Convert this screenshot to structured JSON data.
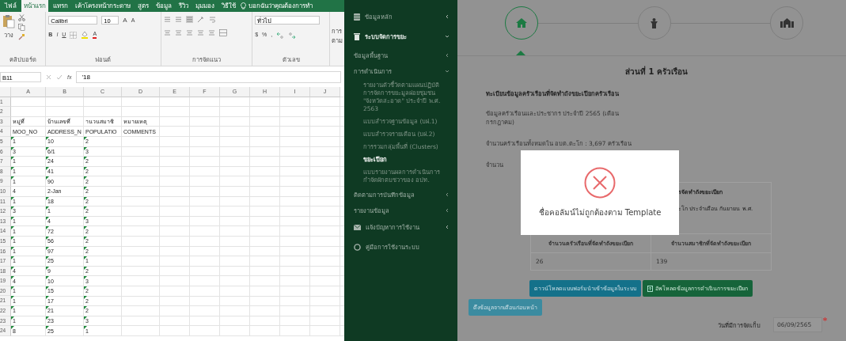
{
  "excel": {
    "tabs": [
      {
        "label": "ไฟล์",
        "selected": false
      },
      {
        "label": "หน้าแรก",
        "selected": true
      },
      {
        "label": "แทรก",
        "selected": false
      },
      {
        "label": "เค้าโครงหน้ากระดาษ",
        "selected": false
      },
      {
        "label": "สูตร",
        "selected": false
      },
      {
        "label": "ข้อมูล",
        "selected": false
      },
      {
        "label": "รีวิว",
        "selected": false
      },
      {
        "label": "มุมมอง",
        "selected": false
      },
      {
        "label": "วิธีใช้",
        "selected": false
      }
    ],
    "tell_me": "บอกฉันว่าคุณต้องการทำ",
    "ribbon": {
      "paste_label": "วาง",
      "font_name": "Calibri",
      "font_size": "10",
      "grow_font": "A",
      "shrink_font": "A",
      "bold": "B",
      "italic": "I",
      "underline": "U",
      "font_color": "A",
      "number_format": "ทั่วไป",
      "currency": "$",
      "percent": "%",
      "comma": ",",
      "cut_label": [
        "การ",
        "ตาม"
      ],
      "groups": [
        "คลิปบอร์ด",
        "ฟอนต์",
        "การจัดแนว",
        "ตัวเลข"
      ]
    },
    "name_box": "B11",
    "function_label": "fx",
    "formula": "'18",
    "columns": [
      "A",
      "B",
      "C",
      "D",
      "E",
      "F",
      "G",
      "H",
      "I",
      "J"
    ],
    "rows": [
      {
        "header": "1"
      },
      {
        "header": "2"
      },
      {
        "header": "3",
        "cells": [
          {
            "text": "หมู่ที่",
            "flag": false
          },
          {
            "text": "บ้านเลขที่",
            "flag": false
          },
          {
            "text": "านวนสมาชิ",
            "flag": false
          },
          {
            "text": "หมายเหตุ",
            "flag": false
          }
        ]
      },
      {
        "header": "4",
        "cells": [
          {
            "text": "MOO_NO",
            "flag": false
          },
          {
            "text": "ADDRESS_N",
            "flag": false
          },
          {
            "text": "POPULATIO",
            "flag": false
          },
          {
            "text": "COMMENTS",
            "flag": false
          }
        ]
      },
      {
        "header": "5",
        "cells": [
          {
            "text": "1",
            "flag": true
          },
          {
            "text": "10",
            "flag": true
          },
          {
            "text": "2",
            "flag": true
          }
        ]
      },
      {
        "header": "6",
        "cells": [
          {
            "text": "3",
            "flag": true
          },
          {
            "text": "6/1",
            "flag": true
          },
          {
            "text": "3",
            "flag": true
          }
        ]
      },
      {
        "header": "7",
        "cells": [
          {
            "text": "1",
            "flag": true
          },
          {
            "text": "24",
            "flag": true
          },
          {
            "text": "2",
            "flag": true
          }
        ]
      },
      {
        "header": "8",
        "cells": [
          {
            "text": "1",
            "flag": true
          },
          {
            "text": "41",
            "flag": true
          },
          {
            "text": "2",
            "flag": true
          }
        ]
      },
      {
        "header": "9",
        "cells": [
          {
            "text": "1",
            "flag": true
          },
          {
            "text": "90",
            "flag": true
          },
          {
            "text": "2",
            "flag": true
          }
        ]
      },
      {
        "header": "10",
        "cells": [
          {
            "text": "4",
            "flag": false
          },
          {
            "text": "2-Jan",
            "flag": false
          },
          {
            "text": "2",
            "flag": true
          }
        ]
      },
      {
        "header": "11",
        "cells": [
          {
            "text": "1",
            "flag": true
          },
          {
            "text": "18",
            "flag": true
          },
          {
            "text": "2",
            "flag": true
          }
        ]
      },
      {
        "header": "12",
        "cells": [
          {
            "text": "3",
            "flag": true
          },
          {
            "text": "1",
            "flag": true
          },
          {
            "text": "2",
            "flag": true
          }
        ]
      },
      {
        "header": "13",
        "cells": [
          {
            "text": "1",
            "flag": true
          },
          {
            "text": "4",
            "flag": true
          },
          {
            "text": "3",
            "flag": true
          }
        ]
      },
      {
        "header": "14",
        "cells": [
          {
            "text": "1",
            "flag": true
          },
          {
            "text": "72",
            "flag": true
          },
          {
            "text": "2",
            "flag": true
          }
        ]
      },
      {
        "header": "15",
        "cells": [
          {
            "text": "1",
            "flag": true
          },
          {
            "text": "56",
            "flag": true
          },
          {
            "text": "2",
            "flag": true
          }
        ]
      },
      {
        "header": "16",
        "cells": [
          {
            "text": "1",
            "flag": true
          },
          {
            "text": "97",
            "flag": true
          },
          {
            "text": "2",
            "flag": true
          }
        ]
      },
      {
        "header": "17",
        "cells": [
          {
            "text": "1",
            "flag": true
          },
          {
            "text": "25",
            "flag": true
          },
          {
            "text": "1",
            "flag": true
          }
        ]
      },
      {
        "header": "18",
        "cells": [
          {
            "text": "4",
            "flag": true
          },
          {
            "text": "9",
            "flag": true
          },
          {
            "text": "2",
            "flag": true
          }
        ]
      },
      {
        "header": "19",
        "cells": [
          {
            "text": "4",
            "flag": true
          },
          {
            "text": "10",
            "flag": true
          },
          {
            "text": "3",
            "flag": true
          }
        ]
      },
      {
        "header": "20",
        "cells": [
          {
            "text": "1",
            "flag": true
          },
          {
            "text": "15",
            "flag": true
          },
          {
            "text": "2",
            "flag": true
          }
        ]
      },
      {
        "header": "21",
        "cells": [
          {
            "text": "1",
            "flag": true
          },
          {
            "text": "17",
            "flag": true
          },
          {
            "text": "2",
            "flag": true
          }
        ]
      },
      {
        "header": "22",
        "cells": [
          {
            "text": "1",
            "flag": true
          },
          {
            "text": "21",
            "flag": true
          },
          {
            "text": "2",
            "flag": true
          }
        ]
      },
      {
        "header": "23",
        "cells": [
          {
            "text": "1",
            "flag": true
          },
          {
            "text": "23",
            "flag": true
          },
          {
            "text": "3",
            "flag": true
          }
        ]
      },
      {
        "header": "24",
        "cells": [
          {
            "text": "8",
            "flag": true
          },
          {
            "text": "25",
            "flag": true
          },
          {
            "text": "1",
            "flag": true
          }
        ]
      }
    ]
  },
  "app": {
    "sidebar": [
      {
        "label": "ข้อมูลหลัก",
        "expanded": false
      },
      {
        "label": "ระบบจัดการขยะ",
        "expanded": true,
        "children": [
          {
            "label": "ข้อมูลพื้นฐาน",
            "expanded": false
          },
          {
            "label": "การดำเนินการ",
            "expanded": true,
            "children": [
              {
                "label": "รายงานตัวชี้วัดตามแผนปฏิบัติการจัดการขยะมูลฝอยชุมชน \"จังหวัดสะอาด\" ประจำปี พ.ศ. 2563",
                "selected": false
              },
              {
                "label": "แบบสำรวจฐานข้อมูล (บฝ.1)",
                "selected": false
              },
              {
                "label": "แบบสำรวจรายเดือน (บฝ.2)",
                "selected": false
              },
              {
                "label": "การรวมกลุ่มพื้นที่ (Clusters)",
                "selected": false
              },
              {
                "label": "ขยะเปียก",
                "selected": true
              },
              {
                "label": "แบบรายงานผลการดำเนินการกำจัดผักตบชวาของ อปท.",
                "selected": false
              }
            ]
          },
          {
            "label": "ติดตามการบันทึกข้อมูล",
            "expanded": false
          },
          {
            "label": "รายงานข้อมูล",
            "expanded": false
          }
        ]
      },
      {
        "label": "แจ้งปัญหาการใช้งาน",
        "expanded": false
      },
      {
        "label": "คู่มือการใช้งานระบบ"
      }
    ],
    "steps": [
      {
        "selected": true
      },
      {
        "selected": false
      },
      {
        "selected": false
      }
    ],
    "section_title": "ส่วนที่ 1 ครัวเรือน",
    "register_title": "ทะเบียนข้อมูลครัวเรือนที่จัดทำถังขยะเปียกครัวเรือน",
    "household_info": "ข้อมูลครัวเรือนและประชากร ประจำปี 2565 (เดือนกรกฎาคม)",
    "household_count": "จำนวนครัวเรือนทั้งหมดใน อบต.ตะโก : 3,697 ครัวเรือน",
    "member_label": "จำนวน",
    "summary": {
      "title_lines": [
        "รจัดทำถังขยะเปียก",
        "ะโก ประจำเดือน กันยายน พ.ศ."
      ],
      "columns": [
        "จำนวนครัวเรือนที่จัดทำถังขยะเปียก",
        "จำนวนสมาชิกที่จัดทำถังขยะเปียก"
      ],
      "values": [
        "26",
        "139"
      ]
    },
    "buttons": [
      {
        "label": "ดาวน์โหลดแบบฟอร์มนำเข้าข้อมูลในระบบ",
        "kind": "download"
      },
      {
        "label": "อัพโหลดข้อมูลการดำเนินการขยะเปียก",
        "kind": "upload"
      },
      {
        "label": "ดึงข้อมูลจากเดือนก่อนหน้า",
        "kind": "pull"
      }
    ],
    "date_field": {
      "label": "วันที่มีการจัดเก็บ",
      "value": "06/09/2565",
      "required": true
    },
    "modal": {
      "message": "ชื่อคอลัมน์ไม่ถูกต้องตาม Template"
    }
  }
}
